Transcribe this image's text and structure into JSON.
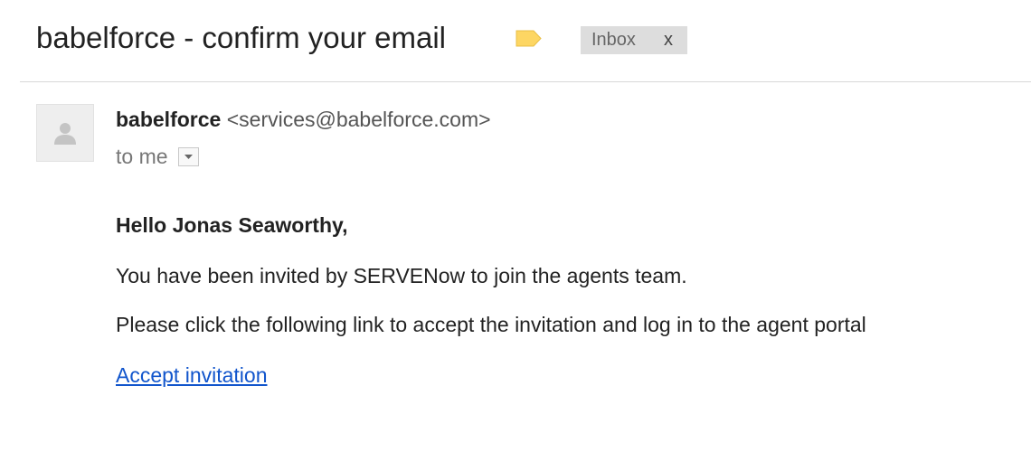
{
  "header": {
    "subject": "babelforce - confirm your email",
    "label_color": "#fdd663",
    "label_icon": "label-tag-icon",
    "inbox_chip": {
      "label": "Inbox",
      "close": "x"
    }
  },
  "message": {
    "sender_name": "babelforce",
    "sender_email": "<services@babelforce.com>",
    "recipient": "to me",
    "details_icon": "dropdown-arrow-icon",
    "avatar_icon": "person-icon"
  },
  "body": {
    "greeting": "Hello Jonas Seaworthy,",
    "paragraph1": "You have been invited by SERVENow to join the agents team.",
    "paragraph2": "Please click the following link to accept the invitation and log in to the agent portal",
    "link_text": "Accept invitation",
    "link_color": "#1155cc"
  }
}
